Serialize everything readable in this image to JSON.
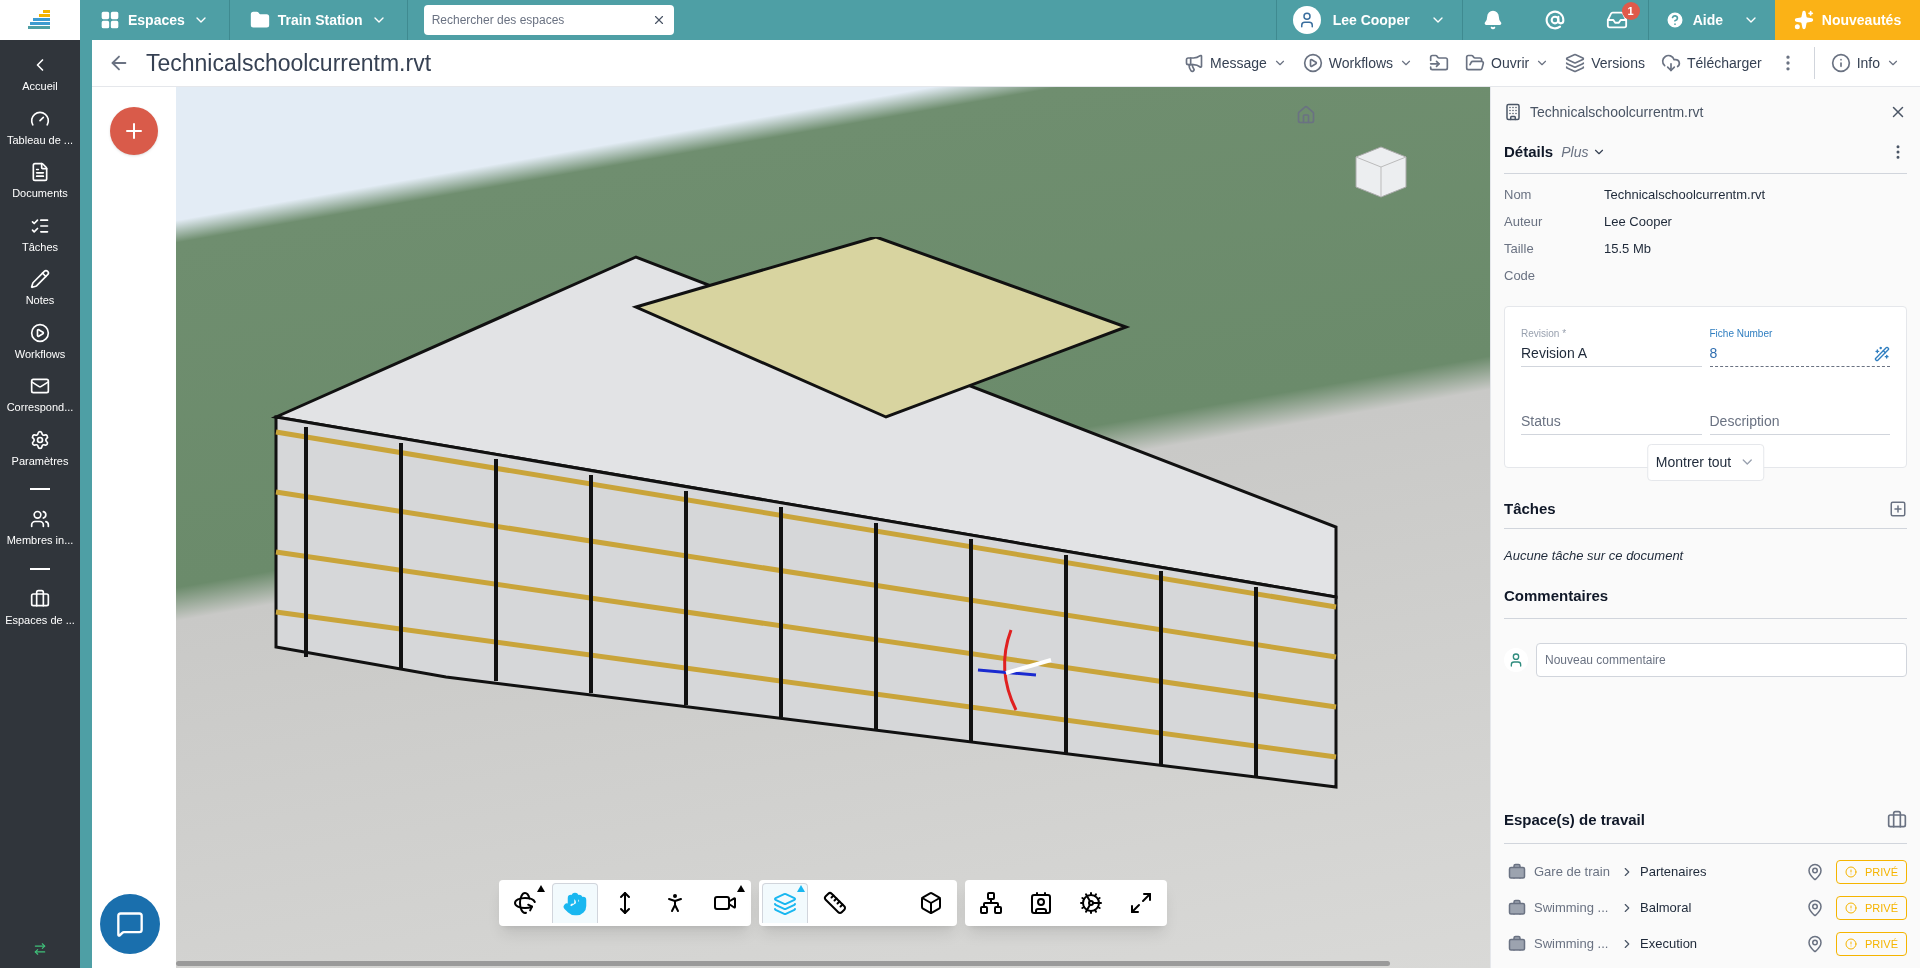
{
  "topbar": {
    "spaces_menu": "Espaces",
    "project_menu": "Train Station",
    "search": {
      "placeholder": "Rechercher des espaces"
    },
    "user": "Lee Cooper",
    "inbox_badge": "1",
    "help": "Aide",
    "news": "Nouveautés"
  },
  "sidebar": {
    "items": [
      {
        "kind": "back",
        "label": "Accueil"
      },
      {
        "kind": "dashboard",
        "label": "Tableau de ..."
      },
      {
        "kind": "document",
        "label": "Documents"
      },
      {
        "kind": "tasks",
        "label": "Tâches"
      },
      {
        "kind": "notes",
        "label": "Notes"
      },
      {
        "kind": "workflows",
        "label": "Workflows"
      },
      {
        "kind": "mail",
        "label": "Correspond..."
      },
      {
        "kind": "settings",
        "label": "Paramètres"
      },
      {
        "kind": "divider"
      },
      {
        "kind": "members",
        "label": "Membres in..."
      },
      {
        "kind": "divider"
      },
      {
        "kind": "briefcase",
        "label": "Espaces de ..."
      }
    ]
  },
  "document": {
    "title": "Technicalschoolcurrentm.rvt"
  },
  "actions": [
    {
      "kind": "message",
      "label": "Message",
      "dropdown": true
    },
    {
      "kind": "workflows",
      "label": "Workflows",
      "dropdown": true
    },
    {
      "kind": "move"
    },
    {
      "kind": "open",
      "label": "Ouvrir",
      "dropdown": true
    },
    {
      "kind": "versions",
      "label": "Versions",
      "dropdown": false
    },
    {
      "kind": "download",
      "label": "Télécharger",
      "dropdown": false
    },
    {
      "kind": "more"
    },
    {
      "kind": "info",
      "label": "Info",
      "dropdown": true
    }
  ],
  "viewer_toolbar": [
    {
      "tools": [
        {
          "kind": "orbit",
          "selected": false,
          "flyout": true
        },
        {
          "kind": "pan",
          "selected": true,
          "flyout": false
        },
        {
          "kind": "zoom",
          "selected": false,
          "flyout": false
        },
        {
          "kind": "walk",
          "selected": false,
          "flyout": false
        },
        {
          "kind": "camera",
          "selected": false,
          "flyout": true
        }
      ]
    },
    {
      "tools": [
        {
          "kind": "section",
          "selected": true,
          "flyout": true
        },
        {
          "kind": "measure",
          "selected": false,
          "flyout": false
        },
        {
          "kind": "explode",
          "selected": false,
          "flyout": false
        }
      ]
    },
    {
      "tools": [
        {
          "kind": "tree",
          "selected": false,
          "flyout": false
        },
        {
          "kind": "properties",
          "selected": false,
          "flyout": false
        },
        {
          "kind": "settings",
          "selected": false,
          "flyout": false
        },
        {
          "kind": "fullscreen",
          "selected": false,
          "flyout": false
        }
      ]
    }
  ],
  "panel": {
    "title": "Technicalschoolcurrentm.rvt",
    "details_heading": "Détails",
    "details_more": "Plus",
    "properties": [
      {
        "label": "Nom",
        "value": "Technicalschoolcurrentm.rvt"
      },
      {
        "label": "Auteur",
        "value": "Lee Cooper"
      },
      {
        "label": "Taille",
        "value": "15.5 Mb"
      },
      {
        "label": "Code"
      }
    ],
    "fields": [
      {
        "label": "Revision *",
        "value": "Revision A",
        "focused": false
      },
      {
        "label": "Fiche Number",
        "value": "8",
        "focused": true
      },
      {
        "placeholder": "Status",
        "focused": false
      },
      {
        "placeholder": "Description",
        "focused": false
      }
    ],
    "show_all": "Montrer tout",
    "tasks_heading": "Tâches",
    "tasks_empty": "Aucune tâche sur ce document",
    "comments_heading": "Commentaires",
    "comment_input": {
      "placeholder": "Nouveau commentaire"
    },
    "workspaces_heading": "Espace(s) de travail",
    "workspaces": [
      {
        "parent": "Gare de train",
        "name": "Partenaires",
        "badge": "PRIVÉ"
      },
      {
        "parent": "Swimming ...",
        "name": "Balmoral",
        "badge": "PRIVÉ"
      },
      {
        "parent": "Swimming ...",
        "name": "Execution",
        "badge": "PRIVÉ"
      }
    ]
  }
}
